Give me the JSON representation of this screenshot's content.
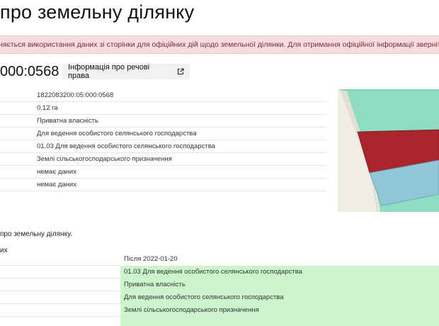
{
  "page": {
    "title": "про земельну ділянку"
  },
  "alert": {
    "text": "няється використання даних зі сторінки для офіційних дій щодо земельної ділянки. Для отримання офіційної інформації зверніться до"
  },
  "parcel": {
    "cadastral_number_fragment": "000:0568",
    "rights_button_label": "Інформація про речові права",
    "rights_button_icon": "external-link-icon"
  },
  "info": {
    "rows": [
      "1822083200:05:000:0568",
      "0.12 га",
      "Приватна власність",
      "Для ведення особистого селянського господарства",
      "01.03 Для ведення особистого селянського господарства",
      "Землі сільськогосподарського призначення",
      "немає даних",
      "немає даних"
    ]
  },
  "map": {
    "colors": {
      "background": "#8fdcc4",
      "road": "#f0ede6",
      "selected_parcel": "#a8262c",
      "neighbor_parcel": "#8fc7d8"
    }
  },
  "changes": {
    "note": "про земельну ділянку.",
    "section_fragment": "их",
    "after_label": "Після 2022-01-20",
    "rows": [
      "01.03 Для ведення особистого селянського господарства",
      "Приватна власність",
      "Для ведення особистого селянського господарства",
      "Землі сільськогосподарського призначення"
    ],
    "highlight_color": "#ccf5cc"
  }
}
